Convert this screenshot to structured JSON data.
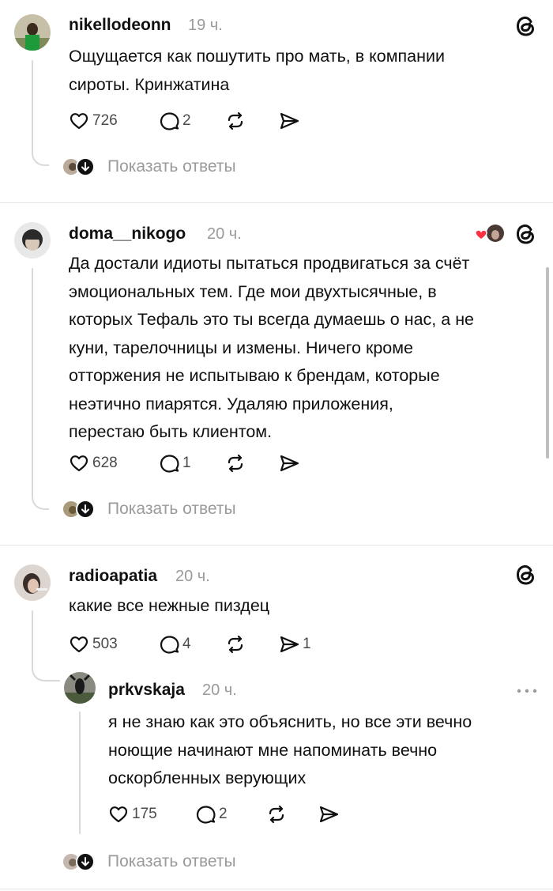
{
  "posts": [
    {
      "username": "nikellodeonn",
      "time": "19 ч.",
      "lines": [
        "Ощущается как пошутить про мать, в компании",
        "сироты. Кринжатина"
      ],
      "likes": "726",
      "replies": "2",
      "reposts": "",
      "shares": "",
      "show_replies": "Показать ответы"
    },
    {
      "username": "doma__nikogo",
      "time": "20 ч.",
      "lines": [
        "Да достали идиоты пытаться продвигаться за счёт",
        "эмоциональных тем. Где мои двухтысячные, в",
        "которых Тефаль это ты всегда думаешь о нас, а не",
        "куни, тарелочницы и измены. Ничего кроме",
        "отторжения не испытываю к брендам, которые",
        "неэтично пиарятся. Удаляю приложения,",
        "перестаю быть клиентом."
      ],
      "likes": "628",
      "replies": "1",
      "reposts": "",
      "shares": "",
      "show_replies": "Показать ответы"
    },
    {
      "username": "radioapatia",
      "time": "20 ч.",
      "lines": [
        "какие все нежные пиздец"
      ],
      "likes": "503",
      "replies": "4",
      "reposts": "",
      "shares": "1"
    },
    {
      "username": "prkvskaja",
      "time": "20 ч.",
      "lines": [
        "я не знаю как это объяснить, но все эти вечно",
        "ноющие начинают мне напоминать вечно",
        "оскорбленных верующих"
      ],
      "likes": "175",
      "replies": "2",
      "reposts": "",
      "shares": "",
      "show_replies": "Показать ответы"
    }
  ],
  "colors": {
    "text": "#101010",
    "muted": "#9a9a9a",
    "divider": "#e6e6e6",
    "like_red": "#ff3040"
  }
}
